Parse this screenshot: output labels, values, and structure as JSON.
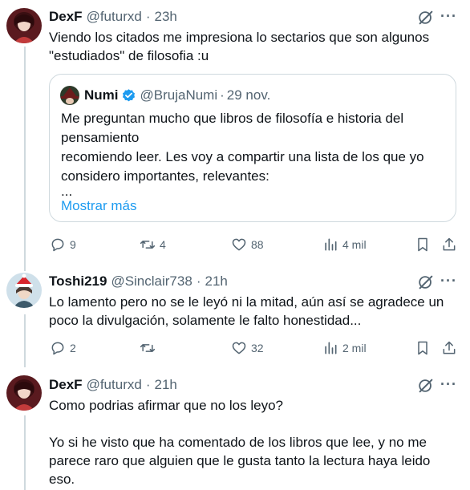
{
  "posts": [
    {
      "name": "DexF",
      "handle": "@futurxd",
      "sep": "·",
      "time": "23h",
      "lines": [
        "Viendo los citados me impresiona lo sectarios que son algunos",
        "\"estudiados\" de filosofia :u"
      ],
      "more": "···",
      "actions": {
        "replies": "9",
        "reposts": "4",
        "likes": "88",
        "views": "4 mil"
      }
    },
    {
      "name": "Toshi219",
      "handle": "@Sinclair738",
      "sep": "·",
      "time": "21h",
      "lines": [
        "Lo lamento pero no se le leyó ni la mitad, aún así se agradece un",
        "poco la divulgación, solamente le falto honestidad..."
      ],
      "more": "···",
      "actions": {
        "replies": "2",
        "reposts": "",
        "likes": "32",
        "views": "2 mil"
      }
    },
    {
      "name": "DexF",
      "handle": "@futurxd",
      "sep": "·",
      "time": "21h",
      "lines": [
        "Como podrias afirmar que no los leyo?",
        "",
        "Yo si he visto que ha comentado de los libros que lee, y no me",
        "parece raro que alguien que le gusta tanto la lectura haya leido",
        "eso."
      ],
      "more": "···"
    }
  ],
  "quote": {
    "name": "Numi",
    "handle": "@BrujaNumi",
    "sep": "·",
    "date": "29 nov.",
    "lines": [
      "Me preguntan mucho que libros de filosofía e historia del",
      "pensamiento",
      "recomiendo leer. Les voy a compartir una lista de los que yo",
      "considero importantes, relevantes:",
      "..."
    ],
    "show_more": "Mostrar más"
  },
  "colors": {
    "accent": "#1d9bf0",
    "muted": "#536471",
    "verified": "#1d9bf0"
  }
}
